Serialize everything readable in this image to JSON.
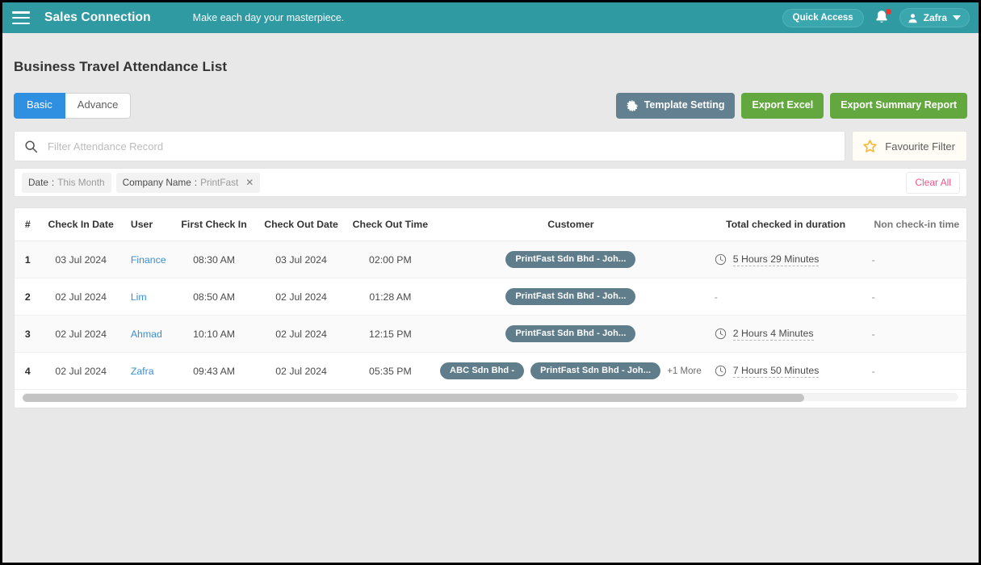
{
  "topbar": {
    "brand": "Sales Connection",
    "tagline": "Make each day your masterpiece.",
    "quick_access": "Quick Access",
    "user_name": "Zafra",
    "accent_color": "#2f9aa2"
  },
  "page": {
    "title": "Business Travel Attendance List"
  },
  "tabs": [
    {
      "label": "Basic",
      "active": true
    },
    {
      "label": "Advance",
      "active": false
    }
  ],
  "actions": {
    "template_setting": "Template Setting",
    "export_excel": "Export Excel",
    "export_summary": "Export Summary Report"
  },
  "search": {
    "placeholder": "Filter Attendance Record",
    "value": "",
    "favourite_filter": "Favourite Filter"
  },
  "filters": {
    "chips": [
      {
        "label": "Date",
        "separator": ":",
        "value": "This Month",
        "removable": false
      },
      {
        "label": "Company Name",
        "separator": ":",
        "value": "PrintFast",
        "removable": true
      }
    ],
    "clear_all": "Clear All"
  },
  "table": {
    "columns": [
      "#",
      "Check In Date",
      "User",
      "First Check In",
      "Check Out Date",
      "Check Out Time",
      "Customer",
      "Total checked in duration",
      "Non check-in time"
    ],
    "rows": [
      {
        "index": "1",
        "check_in_date": "03 Jul 2024",
        "user": "Finance",
        "first_check_in": "08:30 AM",
        "check_out_date": "03 Jul 2024",
        "check_out_time": "02:00 PM",
        "customers": [
          "PrintFast Sdn Bhd - Joh..."
        ],
        "more": "",
        "duration": "5 Hours 29 Minutes",
        "non_check_in_time": "-"
      },
      {
        "index": "2",
        "check_in_date": "02 Jul 2024",
        "user": "Lim",
        "first_check_in": "08:50 AM",
        "check_out_date": "02 Jul 2024",
        "check_out_time": "01:28 AM",
        "customers": [
          "PrintFast Sdn Bhd - Joh..."
        ],
        "more": "",
        "duration": "-",
        "non_check_in_time": "-"
      },
      {
        "index": "3",
        "check_in_date": "02 Jul 2024",
        "user": "Ahmad",
        "first_check_in": "10:10 AM",
        "check_out_date": "02 Jul 2024",
        "check_out_time": "12:15 PM",
        "customers": [
          "PrintFast Sdn Bhd - Joh..."
        ],
        "more": "",
        "duration": "2 Hours 4 Minutes",
        "non_check_in_time": "-"
      },
      {
        "index": "4",
        "check_in_date": "02 Jul 2024",
        "user": "Zafra",
        "first_check_in": "09:43 AM",
        "check_out_date": "02 Jul 2024",
        "check_out_time": "05:35 PM",
        "customers": [
          "ABC Sdn Bhd -",
          "PrintFast Sdn Bhd - Joh..."
        ],
        "more": "+1 More",
        "duration": "7 Hours 50 Minutes",
        "non_check_in_time": "-"
      }
    ]
  },
  "colors": {
    "header_teal": "#2f9aa2",
    "tab_active_blue": "#2f8fe0",
    "green_button": "#62a83e",
    "slate_button": "#62808f",
    "chip_slate": "#607d8b",
    "clear_all_pink": "#f0548c",
    "star_yellow": "#f5b котор"
  }
}
